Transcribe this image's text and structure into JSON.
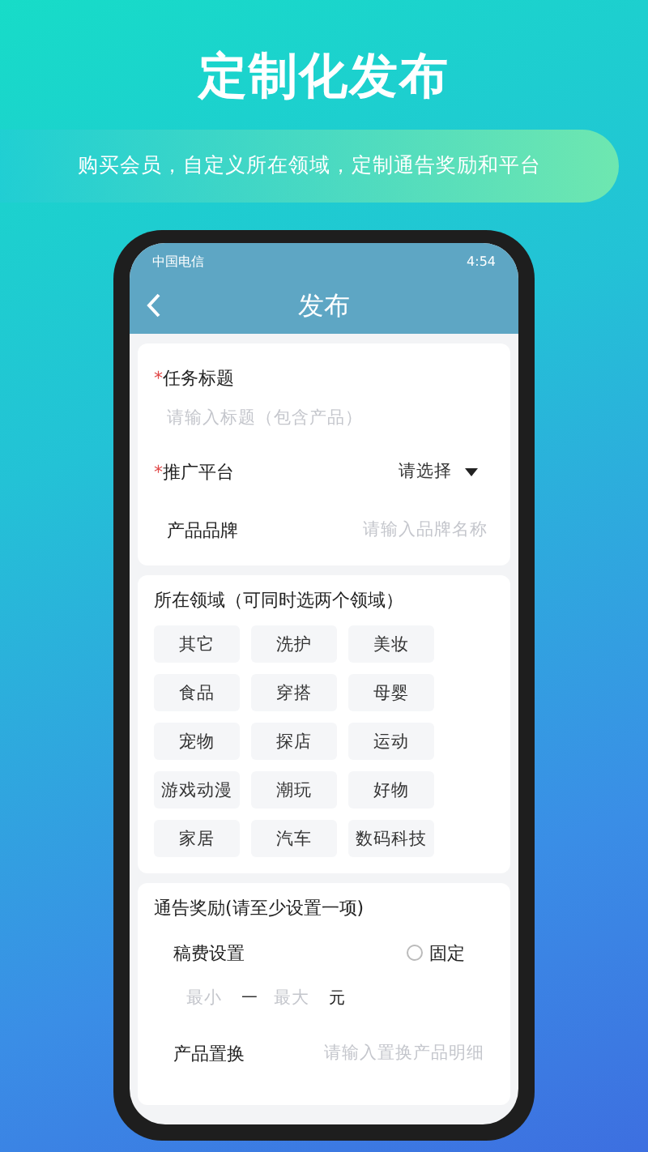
{
  "headline": "定制化发布",
  "tagline": "购买会员，自定义所在领域，定制通告奖励和平台",
  "status_bar": {
    "carrier": "中国电信",
    "time": "4:54"
  },
  "header": {
    "title": "发布"
  },
  "basic_fields": [
    {
      "kind": "stacked",
      "required_mark": "*",
      "label": "任务标题",
      "placeholder": "请输入标题（包含产品）"
    },
    {
      "kind": "select",
      "required_mark": "*",
      "label": "推广平台",
      "value": "请选择"
    },
    {
      "kind": "inline",
      "label": "产品品牌",
      "placeholder": "请输入品牌名称"
    }
  ],
  "domains": {
    "heading": "所在领域（可同时选两个领域）",
    "tags": [
      {
        "label": "其它",
        "selected": false
      },
      {
        "label": "洗护",
        "selected": false
      },
      {
        "label": "美妆",
        "selected": false
      },
      {
        "label": "食品",
        "selected": false
      },
      {
        "label": "穿搭",
        "selected": false
      },
      {
        "label": "母婴",
        "selected": false
      },
      {
        "label": "宠物",
        "selected": false
      },
      {
        "label": "探店",
        "selected": false
      },
      {
        "label": "运动",
        "selected": false
      },
      {
        "label": "游戏动漫",
        "selected": false
      },
      {
        "label": "潮玩",
        "selected": false
      },
      {
        "label": "好物",
        "selected": false
      },
      {
        "label": "家居",
        "selected": false
      },
      {
        "label": "汽车",
        "selected": false
      },
      {
        "label": "数码科技",
        "selected": false
      }
    ]
  },
  "reward": {
    "heading": "通告奖励(请至少设置一项)",
    "fee": {
      "label": "稿费设置",
      "option": "固定",
      "checked": false,
      "min_placeholder": "最小",
      "separator": "一",
      "max_placeholder": "最大",
      "unit": "元"
    },
    "exchange": {
      "label": "产品置换",
      "placeholder": "请输入置换产品明细"
    }
  }
}
